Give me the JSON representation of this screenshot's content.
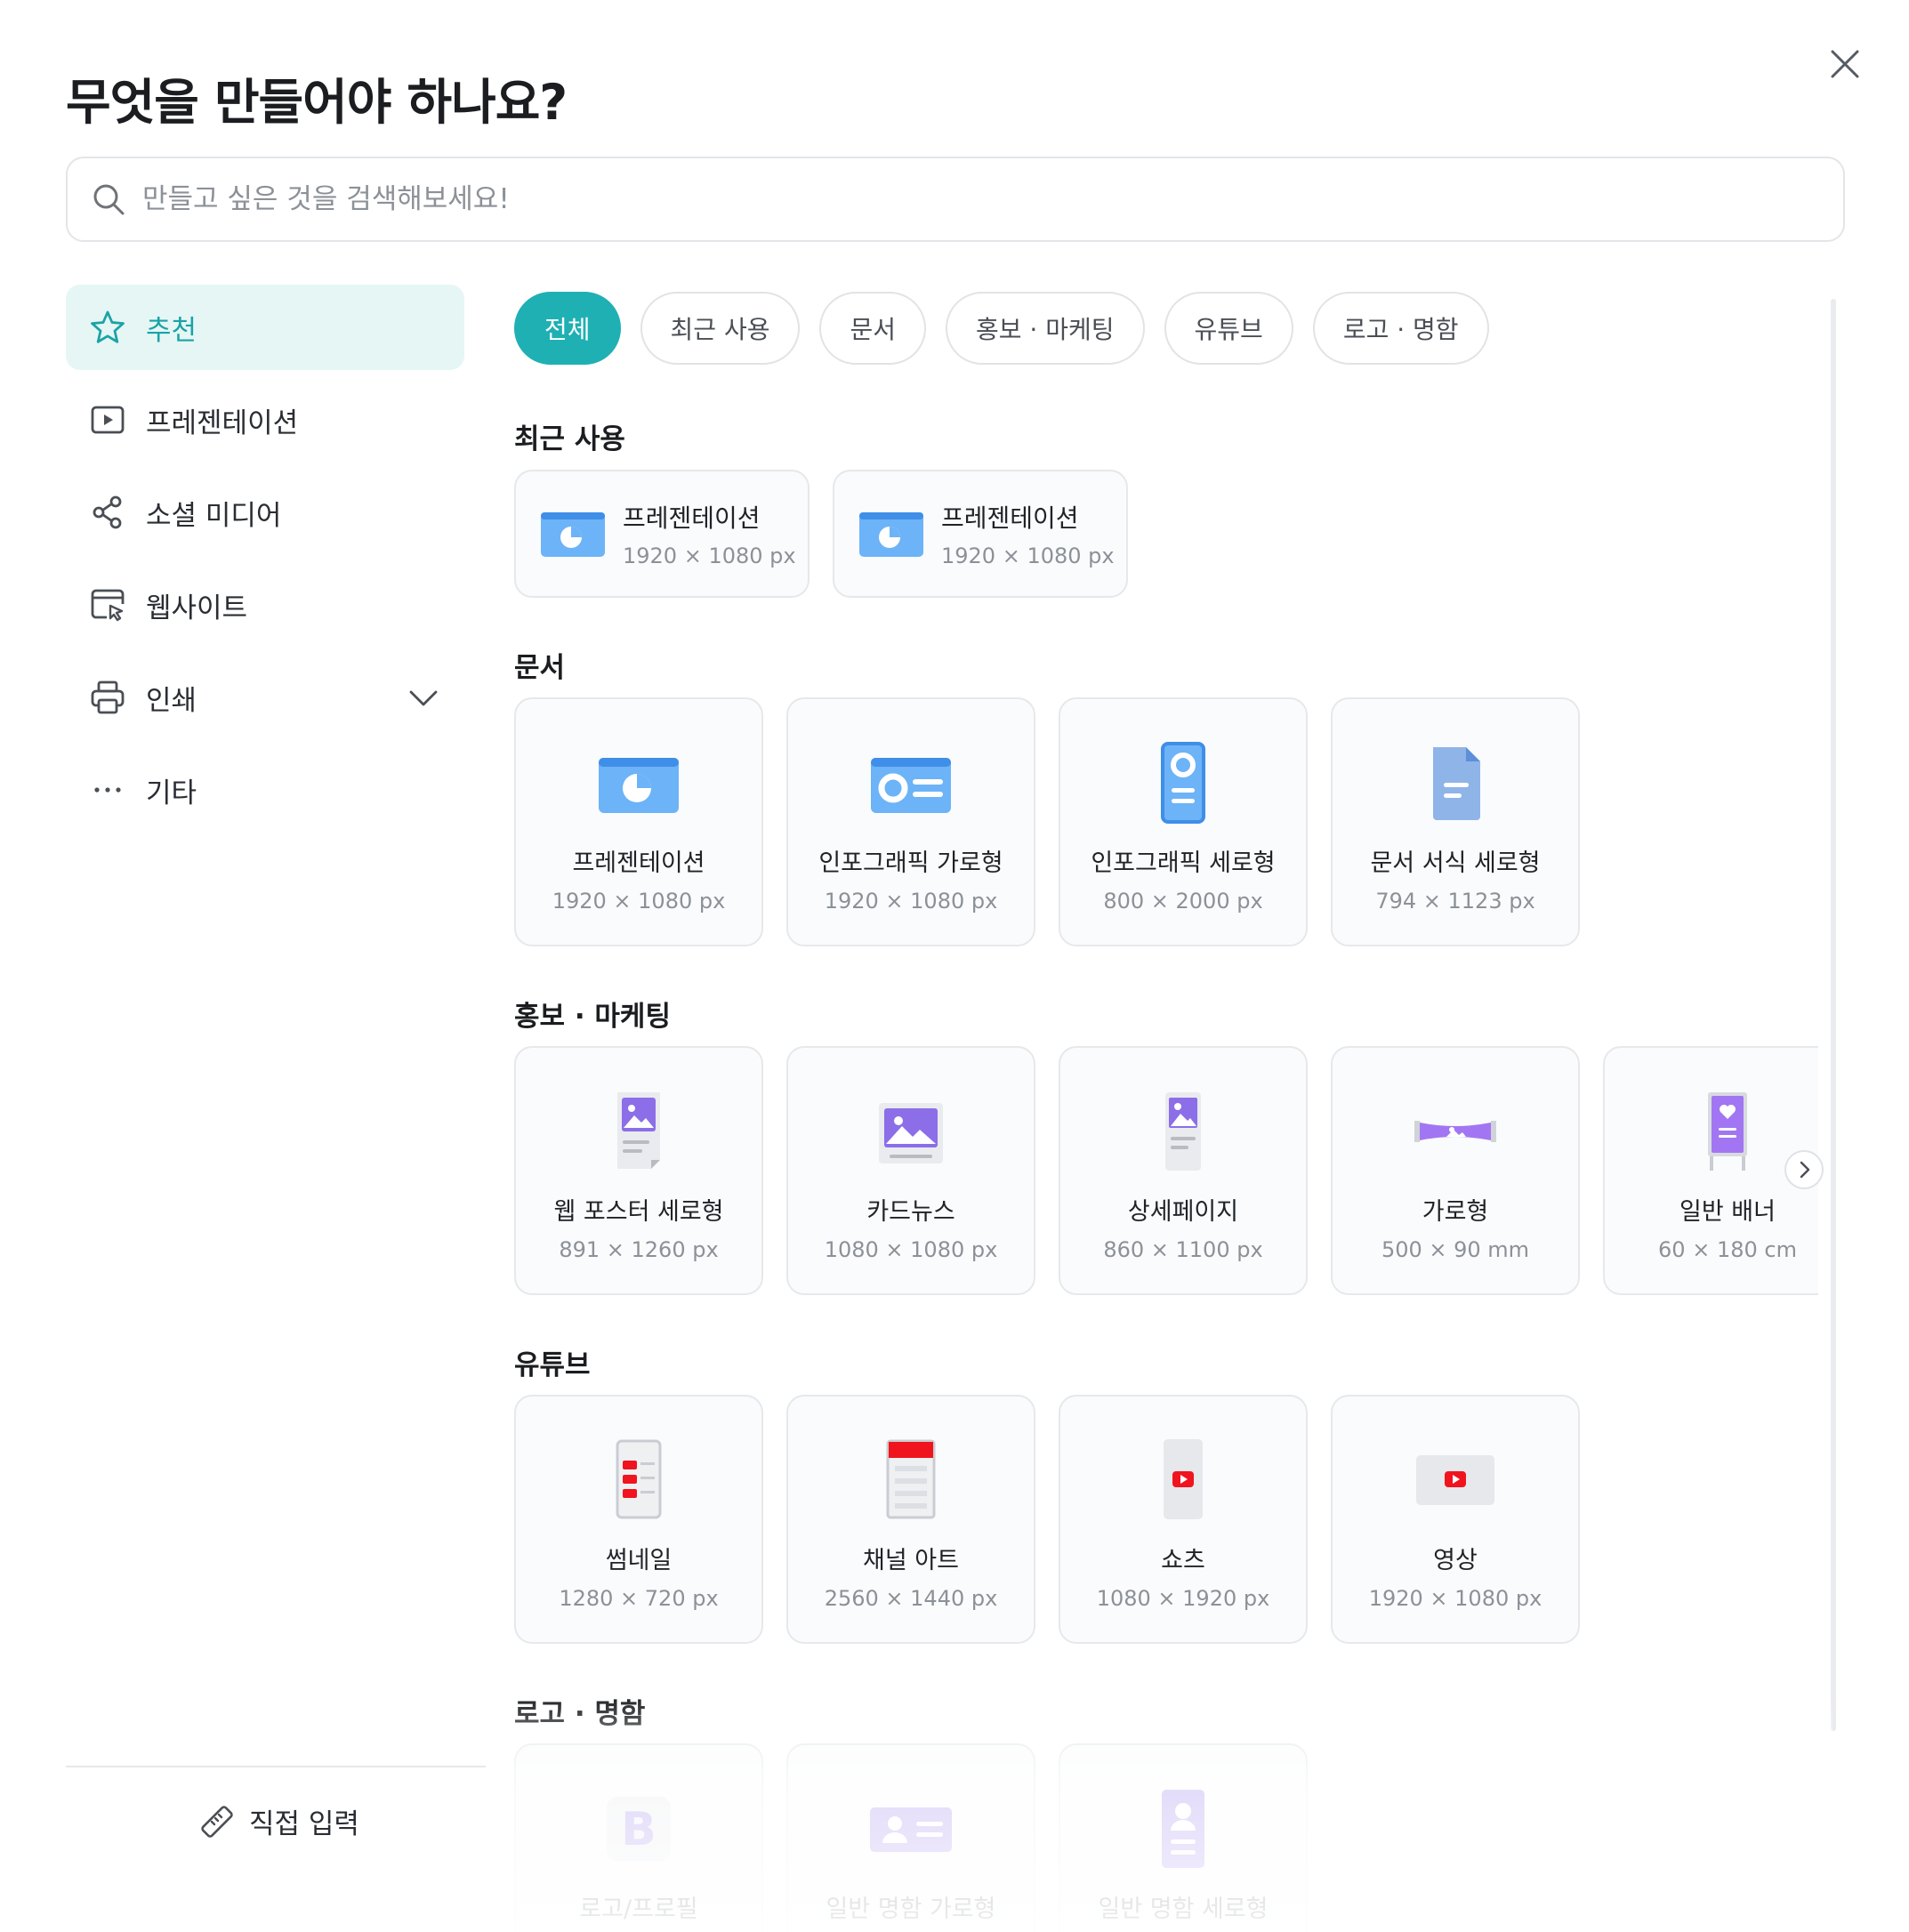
{
  "dialog": {
    "title": "무엇을 만들어야 하나요?"
  },
  "search": {
    "placeholder": "만들고 싶은 것을 검색해보세요!"
  },
  "sidebar": {
    "items": [
      {
        "label": "추천",
        "icon": "star-icon"
      },
      {
        "label": "프레젠테이션",
        "icon": "play-icon"
      },
      {
        "label": "소셜 미디어",
        "icon": "share-icon"
      },
      {
        "label": "웹사이트",
        "icon": "browser-cursor-icon"
      },
      {
        "label": "인쇄",
        "icon": "printer-icon"
      },
      {
        "label": "기타",
        "icon": "more-dots-icon"
      }
    ],
    "direct_input": "직접 입력"
  },
  "chips": [
    "전체",
    "최근 사용",
    "문서",
    "홍보 · 마케팅",
    "유튜브",
    "로고 · 명함"
  ],
  "sections": {
    "recent": {
      "title": "최근 사용",
      "items": [
        {
          "name": "프레젠테이션",
          "size": "1920 × 1080 px"
        },
        {
          "name": "프레젠테이션",
          "size": "1920 × 1080 px"
        }
      ]
    },
    "document": {
      "title": "문서",
      "items": [
        {
          "name": "프레젠테이션",
          "size": "1920 × 1080 px"
        },
        {
          "name": "인포그래픽 가로형",
          "size": "1920 × 1080 px"
        },
        {
          "name": "인포그래픽 세로형",
          "size": "800 × 2000 px"
        },
        {
          "name": "문서 서식 세로형",
          "size": "794 × 1123 px"
        }
      ]
    },
    "marketing": {
      "title": "홍보 · 마케팅",
      "items": [
        {
          "name": "웹 포스터 세로형",
          "size": "891 × 1260 px"
        },
        {
          "name": "카드뉴스",
          "size": "1080 × 1080 px"
        },
        {
          "name": "상세페이지",
          "size": "860 × 1100 px"
        },
        {
          "name": "가로형",
          "size": "500 × 90 mm"
        },
        {
          "name": "일반 배너",
          "size": "60 × 180 cm"
        }
      ]
    },
    "youtube": {
      "title": "유튜브",
      "items": [
        {
          "name": "썸네일",
          "size": "1280 × 720 px"
        },
        {
          "name": "채널 아트",
          "size": "2560 × 1440 px"
        },
        {
          "name": "쇼츠",
          "size": "1080 × 1920 px"
        },
        {
          "name": "영상",
          "size": "1920 × 1080 px"
        }
      ]
    },
    "logo": {
      "title": "로고 · 명함",
      "items": [
        {
          "name": "로고/프로필",
          "size": ""
        },
        {
          "name": "일반 명함 가로형",
          "size": ""
        },
        {
          "name": "일반 명함 세로형",
          "size": ""
        }
      ]
    }
  },
  "colors": {
    "accent": "#1fb0b4",
    "active_bg": "#e6f6f5",
    "youtube_red": "#ff0000",
    "doc_blue": "#5aa7f5",
    "purple": "#9b6cf0"
  }
}
